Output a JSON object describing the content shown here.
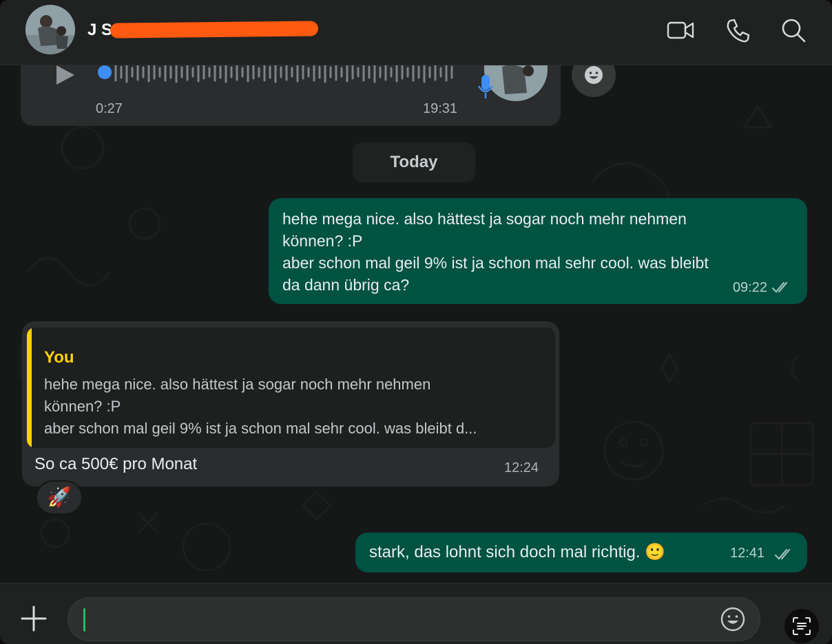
{
  "header": {
    "contact_name": "J  S",
    "icons": [
      "video-call-icon",
      "voice-call-icon",
      "search-icon"
    ]
  },
  "voice_message": {
    "duration": "0:27",
    "time": "19:31"
  },
  "date_separator": "Today",
  "messages": [
    {
      "direction": "outgoing",
      "text": "hehe mega nice. also hättest ja sogar noch mehr nehmen\nkönnen? :P\naber schon mal geil 9% ist ja schon mal sehr cool. was bleibt\nda dann übrig ca?",
      "time": "09:22",
      "status": "read"
    },
    {
      "direction": "incoming",
      "quote": {
        "author": "You",
        "text": "hehe mega nice. also hättest ja sogar noch mehr nehmen\nkönnen? :P\naber schon mal geil 9% ist ja schon mal sehr cool. was bleibt d..."
      },
      "text": "So ca 500€ pro Monat",
      "time": "12:24",
      "reaction": "🚀"
    },
    {
      "direction": "outgoing",
      "text": "stark, das lohnt sich doch mal richtig. 🙂",
      "time": "12:41",
      "status": "read"
    }
  ],
  "composer": {
    "value": "",
    "placeholder": ""
  },
  "colors": {
    "outgoing_bubble": "#005243",
    "incoming_bubble": "#2b2c2d",
    "quote_accent": "#ffd200",
    "redaction": "#ff5a10"
  }
}
